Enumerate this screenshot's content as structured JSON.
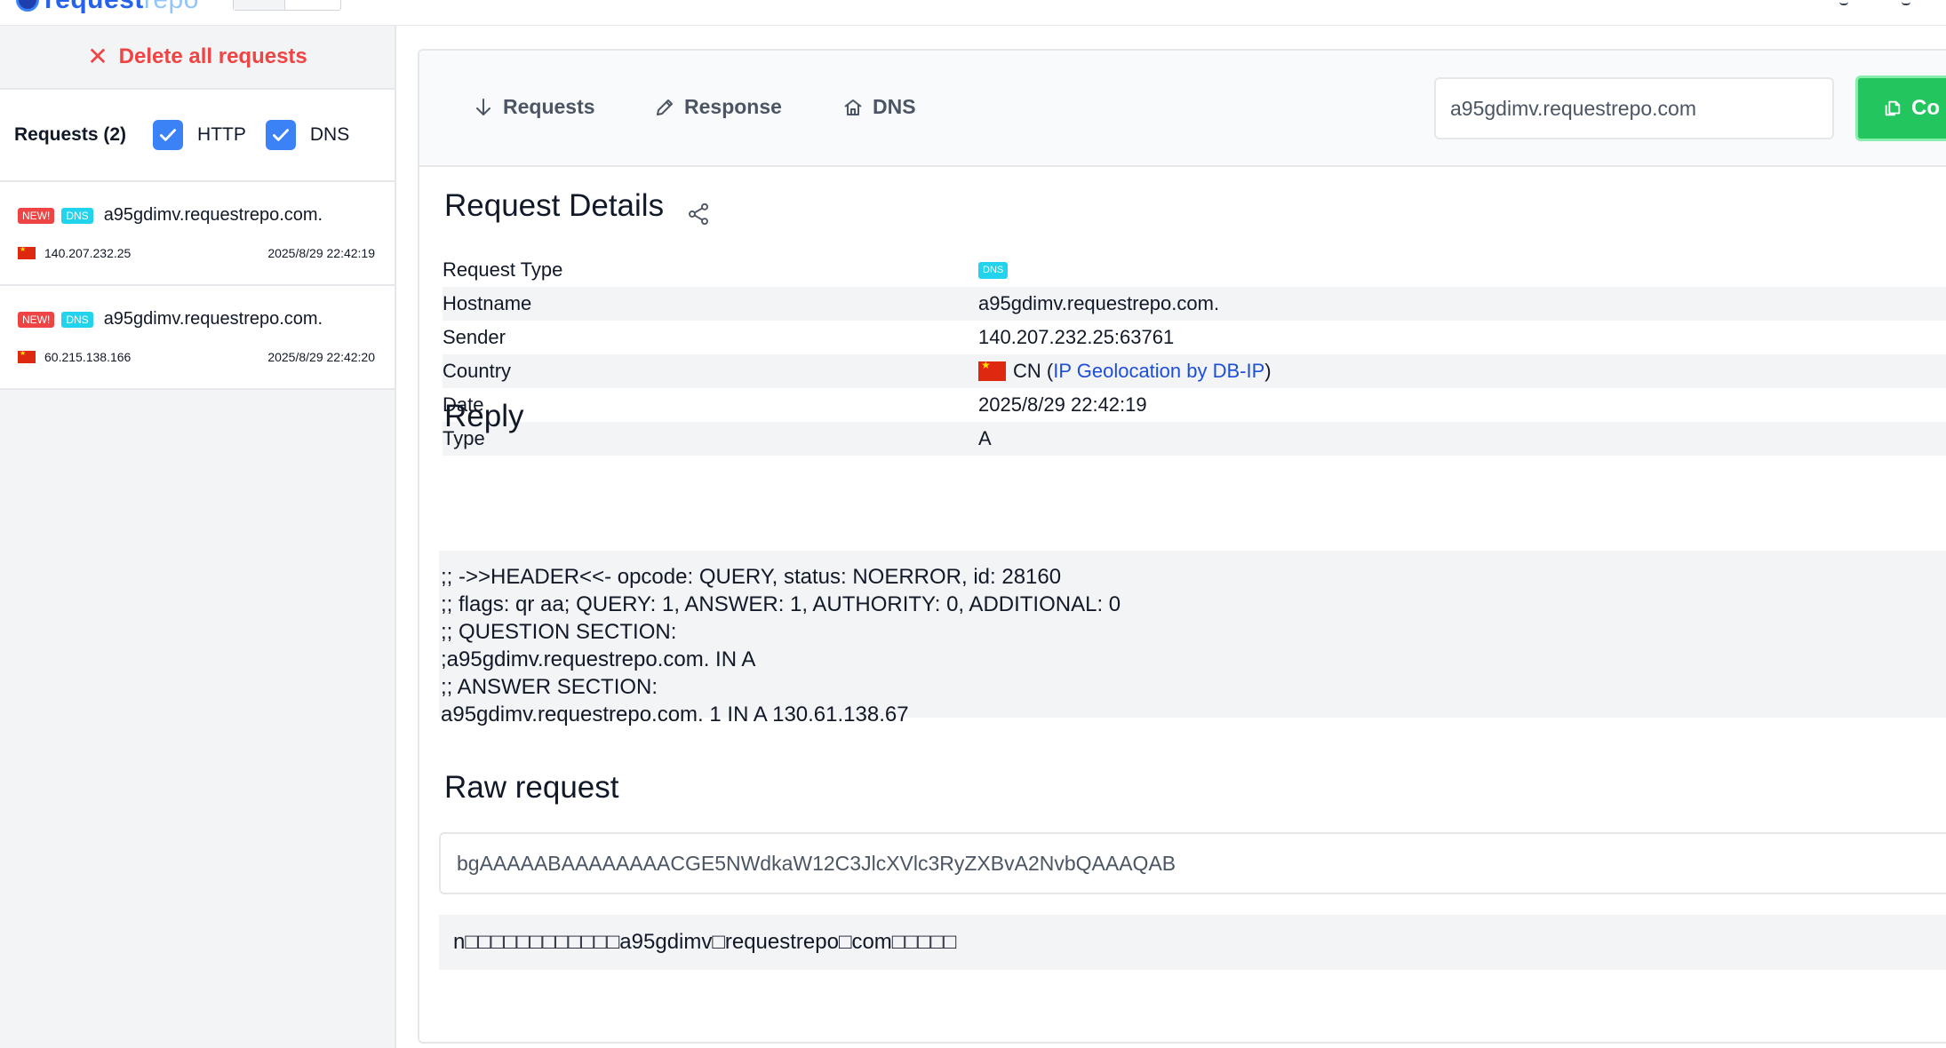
{
  "topbar": {
    "logo_main": "request",
    "logo_light": "repo"
  },
  "sidebar": {
    "delete_all_label": "Delete all requests",
    "requests_count_label": "Requests (2)",
    "filters": [
      {
        "label": "HTTP",
        "checked": true
      },
      {
        "label": "DNS",
        "checked": true
      }
    ],
    "requests": [
      {
        "new_badge": "NEW!",
        "type_badge": "DNS",
        "host": "a95gdimv.requestrepo.com.",
        "ip": "140.207.232.25",
        "timestamp": "2025/8/29 22:42:19"
      },
      {
        "new_badge": "NEW!",
        "type_badge": "DNS",
        "host": "a95gdimv.requestrepo.com.",
        "ip": "60.215.138.166",
        "timestamp": "2025/8/29 22:42:20"
      }
    ]
  },
  "main": {
    "tabs": [
      {
        "label": "Requests",
        "icon": "arrow-down-icon"
      },
      {
        "label": "Response",
        "icon": "pencil-icon"
      },
      {
        "label": "DNS",
        "icon": "house-icon"
      }
    ],
    "url_value": "a95gdimv.requestrepo.com",
    "copy_label": "Co",
    "details_title": "Request Details",
    "details": {
      "request_type": {
        "key": "Request Type",
        "value": "DNS"
      },
      "hostname": {
        "key": "Hostname",
        "value": "a95gdimv.requestrepo.com."
      },
      "sender": {
        "key": "Sender",
        "value": "140.207.232.25:63761"
      },
      "country": {
        "key": "Country",
        "code": "CN",
        "link": "IP Geolocation by DB-IP"
      },
      "date": {
        "key": "Date",
        "value": "2025/8/29 22:42:19"
      },
      "type": {
        "key": "Type",
        "value": "A"
      }
    },
    "reply_title": "Reply",
    "reply_text": ";; ->>HEADER<<- opcode: QUERY, status: NOERROR, id: 28160\n;; flags: qr aa; QUERY: 1, ANSWER: 1, AUTHORITY: 0, ADDITIONAL: 0\n;; QUESTION SECTION:\n;a95gdimv.requestrepo.com. IN A\n;; ANSWER SECTION:\na95gdimv.requestrepo.com. 1 IN A 130.61.138.67",
    "raw_title": "Raw request",
    "raw_base64": "bgAAAAABAAAAAAAACGE5NWdkaW12C3JlcXVlc3RyZXBvA2NvbQAAAQAB",
    "raw_decoded": "n□□□□□□□□□□□□a95gdimv□requestrepo□com□□□□□"
  }
}
